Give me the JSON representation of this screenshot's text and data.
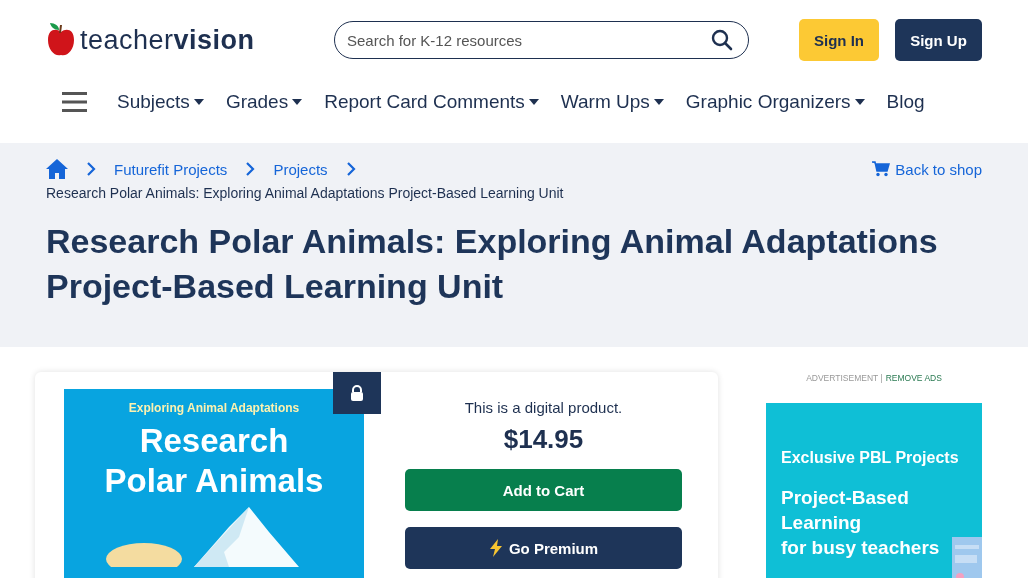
{
  "header": {
    "logo": {
      "light": "teacher",
      "bold": "vision"
    },
    "search": {
      "placeholder": "Search for K-12 resources"
    },
    "buttons": [
      {
        "label": "Sign In",
        "kind": "primary"
      },
      {
        "label": "Sign Up",
        "kind": "dark"
      }
    ]
  },
  "nav": [
    {
      "label": "Subjects",
      "dropdown": true
    },
    {
      "label": "Grades",
      "dropdown": true
    },
    {
      "label": "Report Card Comments",
      "dropdown": true
    },
    {
      "label": "Warm Ups",
      "dropdown": true
    },
    {
      "label": "Graphic Organizers",
      "dropdown": true
    },
    {
      "label": "Blog",
      "dropdown": false
    }
  ],
  "breadcrumbs": [
    "Futurefit Projects",
    "Projects"
  ],
  "back_link": "Back to shop",
  "current_page": "Research Polar Animals: Exploring Animal Adaptations Project-Based Learning Unit",
  "title": "Research Polar Animals: Exploring Animal Adaptations Project-Based Learning Unit",
  "product": {
    "locked": true,
    "cover": {
      "subtitle": "Exploring Animal Adaptations",
      "title": "Research Polar Animals"
    },
    "note": "This is a digital product.",
    "price": "$14.95",
    "buttons": [
      {
        "label": "Add to Cart",
        "kind": "cart"
      },
      {
        "label": "Go Premium",
        "kind": "premium"
      }
    ]
  },
  "ad": {
    "label": "ADVERTISEMENT |",
    "remove": "REMOVE ADS",
    "kicker": "Exclusive PBL Projects",
    "headline": [
      "Project-Based",
      "Learning",
      "for busy teachers"
    ]
  }
}
